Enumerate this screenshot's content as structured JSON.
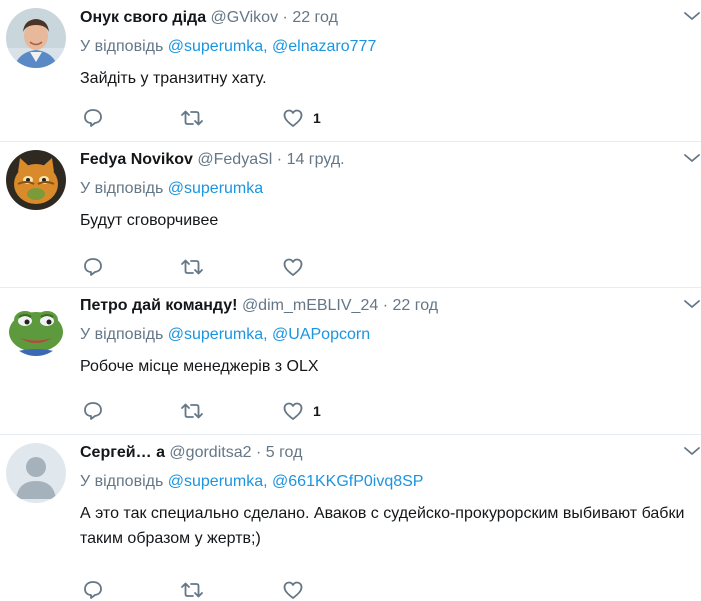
{
  "tweets": [
    {
      "name": "Онук свого діда",
      "handle": "@GVikov",
      "dot": "·",
      "time": "22 год",
      "reply_prefix": "У відповідь",
      "mentions": [
        "@superumka",
        "@elnazaro777"
      ],
      "text": "Зайдіть у транзитну хату.",
      "like_count": "1",
      "avatar_icon": "person-photo-avatar"
    },
    {
      "name": "Fedya Novikov",
      "handle": "@FedyaSl",
      "dot": "·",
      "time": "14 груд.",
      "reply_prefix": "У відповідь",
      "mentions": [
        "@superumka"
      ],
      "text": "Будут сговорчивее",
      "like_count": "",
      "avatar_icon": "cat-photo-avatar"
    },
    {
      "name": "Петро дай команду!",
      "handle": "@dim_mEBLIV_24",
      "dot": "·",
      "time": "22 год",
      "reply_prefix": "У відповідь",
      "mentions": [
        "@superumka",
        "@UAPopcorn"
      ],
      "text": "Робоче місце менеджерів з OLX",
      "like_count": "1",
      "avatar_icon": "frog-avatar"
    },
    {
      "name": "Сергей… а",
      "handle": "@gorditsa2",
      "dot": "·",
      "time": "5 год",
      "reply_prefix": "У відповідь",
      "mentions": [
        "@superumka",
        "@661KKGfP0ivq8SP"
      ],
      "text": "А это так специально сделано. Аваков с судейско-прокурорским выбивают бабки таким образом у жертв;)",
      "like_count": "",
      "avatar_icon": "default-user-avatar"
    }
  ],
  "colors": {
    "link": "#1b95e0",
    "secondary": "#657786",
    "text": "#14171a",
    "divider": "#e6ecf0"
  }
}
